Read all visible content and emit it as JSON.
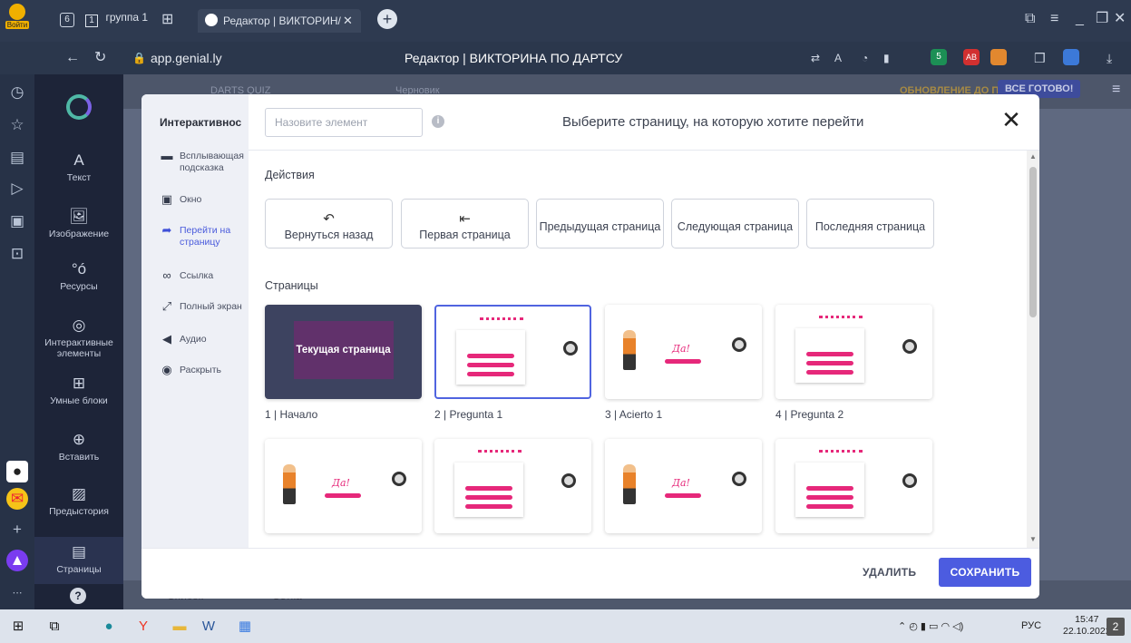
{
  "browser": {
    "login_label": "Войти",
    "tab_count": "6",
    "group_tab": "группа 1",
    "active_tab": "Редактор | ВИКТОРИН/",
    "url": "app.genial.ly",
    "page_title": "Редактор | ВИКТОРИНА ПО ДАРТСУ",
    "bell_badge": "1",
    "mail_badge": "5",
    "ext_badge": "6"
  },
  "app_nav": {
    "items": [
      {
        "label": "Текст",
        "icon": "text-icon"
      },
      {
        "label": "Изображение",
        "icon": "image-icon"
      },
      {
        "label": "Ресурсы",
        "icon": "resources-icon"
      },
      {
        "label": "Интерактивные элементы",
        "icon": "interactive-icon"
      },
      {
        "label": "Умные блоки",
        "icon": "smart-blocks-icon"
      },
      {
        "label": "Вставить",
        "icon": "insert-icon"
      },
      {
        "label": "Предыстория",
        "icon": "background-icon"
      },
      {
        "label": "Страницы",
        "icon": "pages-icon"
      }
    ]
  },
  "editor": {
    "project_name": "DARTS QUIZ",
    "draft_label": "Черновик",
    "upgrade_label": "ОБНОВЛЕНИЕ ДО ПРЕМИУМ",
    "ready_label": "ВСЕ ГОТОВО!",
    "list_tab": "Список",
    "grid_tab": "Сетка"
  },
  "modal": {
    "sidebar_title": "Интерактивнос",
    "sidebar_items": [
      {
        "label": "Всплывающая подсказка",
        "icon": "tooltip-icon"
      },
      {
        "label": "Окно",
        "icon": "window-icon"
      },
      {
        "label": "Перейти на страницу",
        "icon": "go-to-page-icon",
        "active": true
      },
      {
        "label": "Ссылка",
        "icon": "link-icon"
      },
      {
        "label": "Полный экран",
        "icon": "fullscreen-icon"
      },
      {
        "label": "Аудио",
        "icon": "audio-icon"
      },
      {
        "label": "Раскрыть",
        "icon": "reveal-icon"
      }
    ],
    "name_placeholder": "Назовите элемент",
    "title": "Выберите страницу, на которую хотите перейти",
    "actions_title": "Действия",
    "actions": [
      {
        "label": "Вернуться назад",
        "icon": "undo-icon"
      },
      {
        "label": "Первая страница",
        "icon": "first-page-icon"
      },
      {
        "label": "Предыдущая страница",
        "icon": ""
      },
      {
        "label": "Следующая страница",
        "icon": ""
      },
      {
        "label": "Последняя страница",
        "icon": ""
      }
    ],
    "pages_title": "Страницы",
    "current_page_label": "Текущая страница",
    "pages": [
      {
        "caption": "1 | Начало",
        "kind": "current"
      },
      {
        "caption": "2 | Pregunta 1",
        "kind": "question",
        "selected": true
      },
      {
        "caption": "3 | Acierto 1",
        "kind": "correct"
      },
      {
        "caption": "4 | Pregunta 2",
        "kind": "question"
      },
      {
        "caption": "",
        "kind": "correct"
      },
      {
        "caption": "",
        "kind": "question"
      },
      {
        "caption": "",
        "kind": "correct"
      },
      {
        "caption": "",
        "kind": "question"
      }
    ],
    "correct_text": "Да!",
    "delete_label": "УДАЛИТЬ",
    "save_label": "СОХРАНИТЬ"
  },
  "taskbar": {
    "lang": "РУС",
    "time": "15:47",
    "date": "22.10.2022",
    "notif_count": "2"
  },
  "colors": {
    "accent": "#4c5ce0",
    "pink": "#e6287a",
    "nav_bg": "#1d2438"
  }
}
